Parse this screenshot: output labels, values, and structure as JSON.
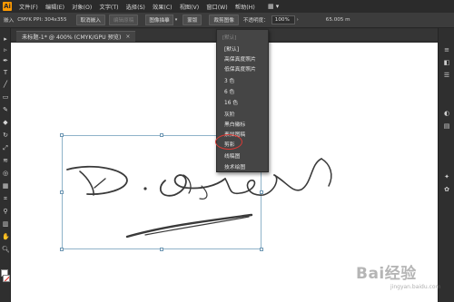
{
  "app": {
    "logo_text": "Ai"
  },
  "menubar": {
    "items": [
      "文件(F)",
      "编辑(E)",
      "对象(O)",
      "文字(T)",
      "选择(S)",
      "效果(C)",
      "视图(V)",
      "窗口(W)",
      "帮助(H)"
    ],
    "layout_icon": "▦ ▾"
  },
  "controlbar": {
    "embed_label": "嵌入",
    "info": "CMYK  PPI: 304x355",
    "unembed_button": "取消嵌入",
    "edit_original_button": "编辑原稿",
    "trace_preset": "图像描摹",
    "mask_button": "蒙版",
    "crop_button": "裁剪图像",
    "opacity_label": "不透明度：",
    "opacity_value": "100%",
    "right_value": "65.005 m"
  },
  "tab": {
    "title": "未标题-1* @ 400% (CMYK/GPU 预览)",
    "close": "×"
  },
  "dropdown": {
    "header": "[默认]",
    "items": [
      "[默认]",
      "高保真度照片",
      "低保真度照片",
      "3 色",
      "6 色",
      "16 色",
      "灰阶",
      "黑白徽标",
      "素描图稿",
      "剪影",
      "线稿图",
      "技术绘图"
    ],
    "highlighted": "剪影"
  },
  "watermark": {
    "text": "Bai经验",
    "sub": "jingyan.baidu.com"
  },
  "colors": {
    "accent": "#ff9a00",
    "highlight_circle": "#d93a35",
    "bbox": "#8fb3c9"
  }
}
